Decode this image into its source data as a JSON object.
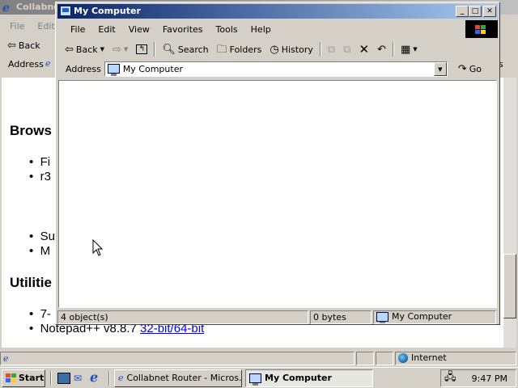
{
  "background_window": {
    "title": "Collabnet",
    "menu": [
      "File",
      "Edit"
    ],
    "back_label": "Back",
    "address_label": "Address",
    "heading_browsers": "Brows",
    "browser_items": [
      "Fi",
      "r3"
    ],
    "items_lower": [
      "Su",
      "M"
    ],
    "heading_utilities": "Utilitie",
    "utility_items": [
      {
        "text": "7-",
        "link": ""
      },
      {
        "text": "Notepad++ v8.8.7 ",
        "link": "32-bit/64-bit"
      }
    ],
    "status_zone": "Internet",
    "edge_text": "s"
  },
  "window": {
    "title": "My Computer",
    "menu": [
      "File",
      "Edit",
      "View",
      "Favorites",
      "Tools",
      "Help"
    ],
    "toolbar": {
      "back": "Back",
      "search": "Search",
      "folders": "Folders",
      "history": "History"
    },
    "address_label": "Address",
    "address_value": "My Computer",
    "go_label": "Go",
    "status": {
      "objects": "4 object(s)",
      "size": "0 bytes",
      "zone": "My Computer"
    }
  },
  "taskbar": {
    "start_label": "Start",
    "tasks": [
      {
        "label": "Collabnet Router - Micros...",
        "pressed": false
      },
      {
        "label": "My Computer",
        "pressed": true
      }
    ],
    "clock": "9:47 PM"
  },
  "colors": {
    "title_active": "#0a246a",
    "title_inactive": "#808080",
    "face": "#d4d0c8",
    "link": "#0000ee"
  }
}
